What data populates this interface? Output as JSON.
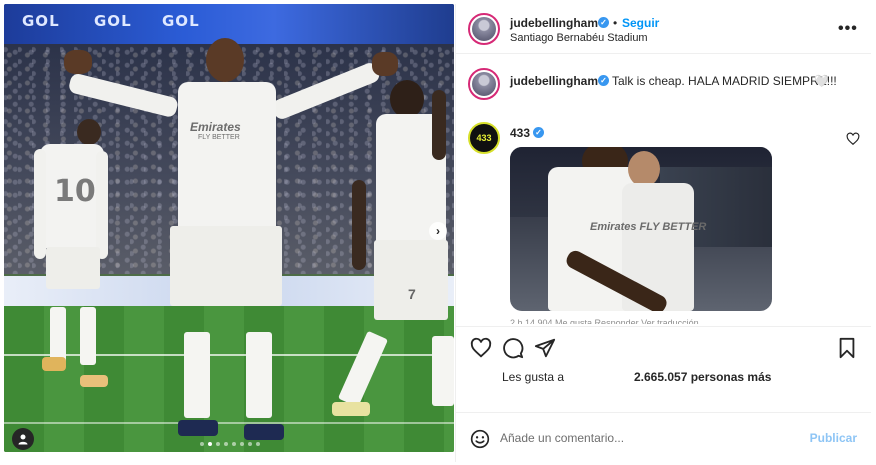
{
  "photo": {
    "banner_texts": [
      "GOL",
      "GOL",
      "GOL"
    ],
    "shirt_brand": "Emirates",
    "shirt_sub": "FLY BETTER",
    "number_left": "10",
    "number_right": "7",
    "carousel": {
      "count": 8,
      "active": 1
    }
  },
  "post": {
    "author": "jude bellingham",
    "author_username": "judebellingham",
    "follow_label": "Seguir",
    "separator": "•",
    "location": "Santiago Bernabéu Stadium",
    "more_label": "•••"
  },
  "caption": {
    "username": "judebellingham",
    "text": "Talk is cheap. HALA MADRID SIEMPRE!!!",
    "emoji": "🤍"
  },
  "comment": {
    "username": "433",
    "avatar_text": "433",
    "media_caption": "Emirates FLY BETTER",
    "meta": "2 h    14.904 Me gusta    Responder    Ver traducción"
  },
  "likes": {
    "prefix": "Les gusta a",
    "count_text": "2.665.057 personas más"
  },
  "comment_bar": {
    "placeholder": "Añade un comentario...",
    "publish_label": "Publicar"
  },
  "colors": {
    "verified": "#3897f0",
    "follow": "#0095f6",
    "publish": "#8ec5f5"
  },
  "icons": [
    "user-tag-icon",
    "next-arrow-icon",
    "verified-icon",
    "more-icon",
    "heart-icon",
    "comment-icon",
    "share-icon",
    "bookmark-icon",
    "emoji-icon"
  ]
}
